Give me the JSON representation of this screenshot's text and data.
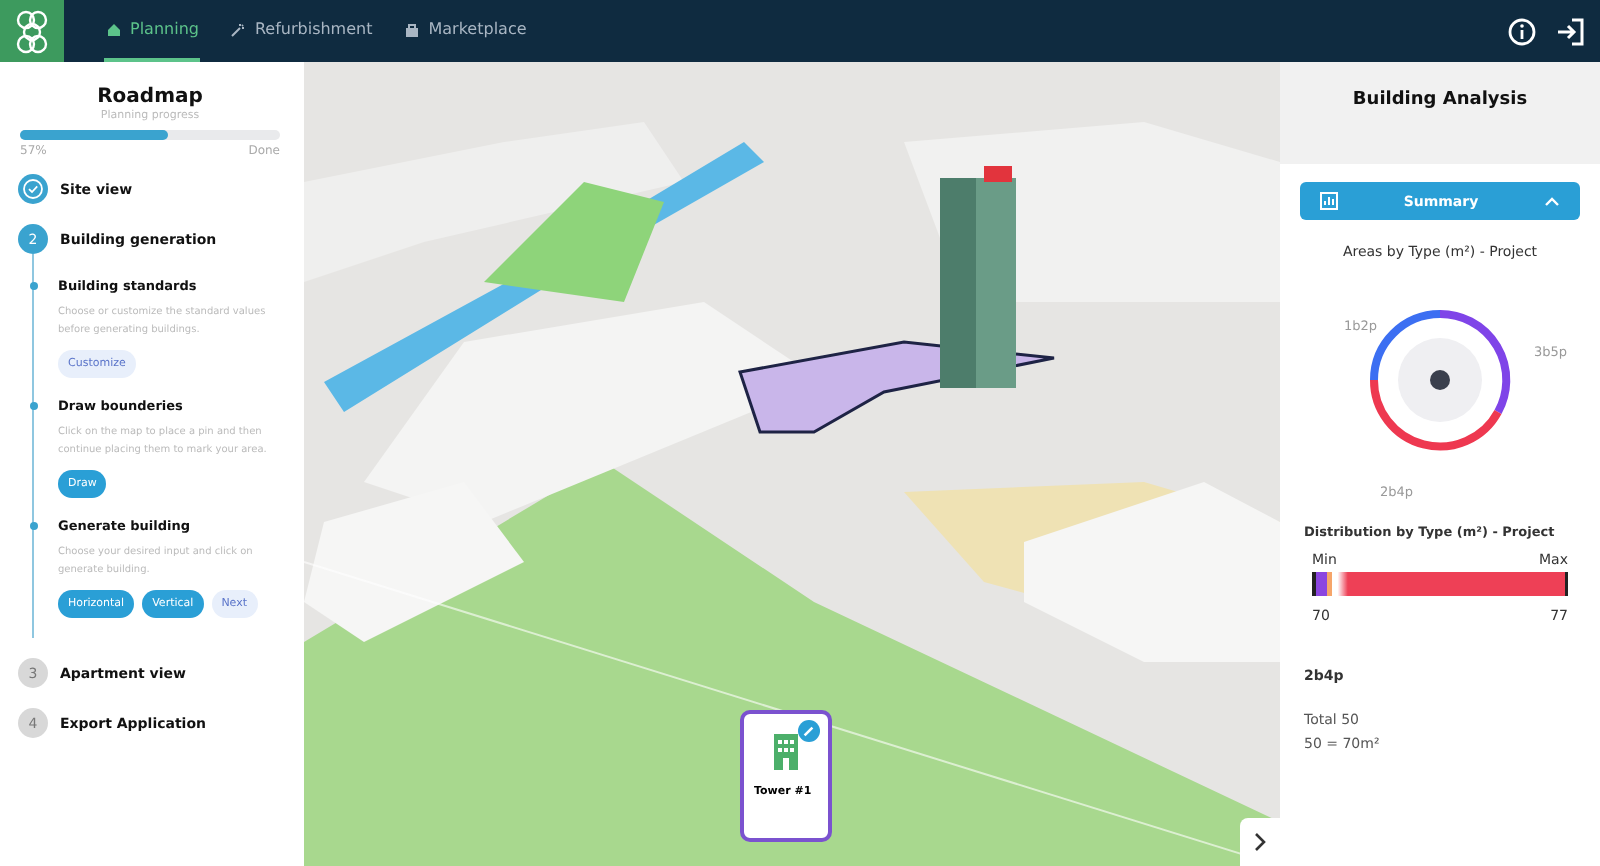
{
  "nav": {
    "tabs": [
      {
        "label": "Planning",
        "selected": true
      },
      {
        "label": "Refurbishment",
        "selected": false
      },
      {
        "label": "Marketplace",
        "selected": false
      }
    ]
  },
  "roadmap": {
    "title": "Roadmap",
    "progress_label": "Planning progress",
    "level": 0.57,
    "percent": "57%",
    "end_label": "Done",
    "steps": [
      {
        "kind": "done",
        "label": "Site view"
      },
      {
        "kind": "current",
        "number": "2",
        "label": "Building generation",
        "children": [
          {
            "title": "Building standards",
            "description": "Choose or customize the standard values before generating buildings.",
            "buttons": [
              {
                "label": "Customize",
                "kind": "secondary"
              }
            ]
          },
          {
            "title": "Draw bounderies",
            "description": "Click on the map to place a pin and then continue placing them to mark your area.",
            "buttons": [
              {
                "label": "Draw",
                "kind": "primary"
              }
            ]
          },
          {
            "title": "Generate building",
            "description": "Choose your desired input and click on generate building.",
            "buttons": [
              {
                "label": "Horizontal",
                "kind": "primary"
              },
              {
                "label": "Vertical",
                "kind": "primary"
              },
              {
                "label": "Next",
                "kind": "secondary"
              }
            ]
          }
        ]
      },
      {
        "kind": "pending",
        "number": "3",
        "label": "Apartment view"
      },
      {
        "kind": "pending",
        "number": "4",
        "label": "Export Application"
      }
    ]
  },
  "map": {
    "building_card": {
      "label": "Tower #1"
    }
  },
  "analysis": {
    "title": "Building Analysis",
    "section": {
      "title": "Summary",
      "expanded": true
    },
    "areas_title": "Areas by Type (m²) - Project",
    "donut_labels": [
      "1b2p",
      "3b5p",
      "2b4p"
    ],
    "distribution": {
      "title": "Distribution by Type (m²) - Project",
      "min_label": "Min",
      "max_label": "Max",
      "min_value": "70",
      "max_value": "77"
    },
    "selected_type": "2b4p",
    "total": "Total 50",
    "breakdown": "50 = 70m²"
  }
}
